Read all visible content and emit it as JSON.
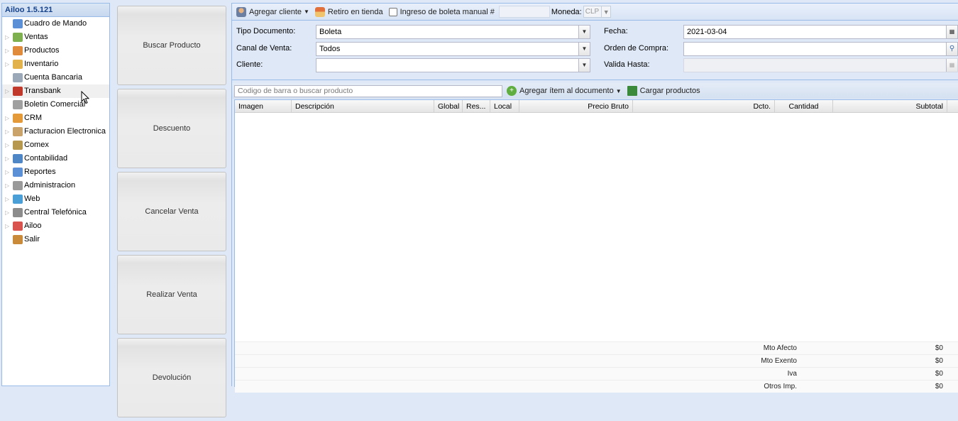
{
  "sidebar": {
    "title": "Ailoo 1.5.121",
    "items": [
      {
        "label": "Cuadro de Mando",
        "expandable": false,
        "icon": "dashboard-icon",
        "color": "#5b8fd6"
      },
      {
        "label": "Ventas",
        "expandable": true,
        "icon": "sales-icon",
        "color": "#7fb04f"
      },
      {
        "label": "Productos",
        "expandable": true,
        "icon": "products-icon",
        "color": "#e08a3c"
      },
      {
        "label": "Inventario",
        "expandable": true,
        "icon": "inventory-icon",
        "color": "#e2b34c"
      },
      {
        "label": "Cuenta Bancaria",
        "expandable": false,
        "icon": "bank-icon",
        "color": "#9aa8b8"
      },
      {
        "label": "Transbank",
        "expandable": true,
        "icon": "transbank-icon",
        "color": "#c0392b"
      },
      {
        "label": "Boletin Comercial",
        "expandable": false,
        "icon": "bulletin-icon",
        "color": "#a0a0a0"
      },
      {
        "label": "CRM",
        "expandable": true,
        "icon": "crm-icon",
        "color": "#e59a3a"
      },
      {
        "label": "Facturacion Electronica",
        "expandable": true,
        "icon": "invoice-icon",
        "color": "#c9a36a"
      },
      {
        "label": "Comex",
        "expandable": true,
        "icon": "comex-icon",
        "color": "#b7984f"
      },
      {
        "label": "Contabilidad",
        "expandable": true,
        "icon": "accounting-icon",
        "color": "#4f86c6"
      },
      {
        "label": "Reportes",
        "expandable": true,
        "icon": "reports-icon",
        "color": "#5b8fd6"
      },
      {
        "label": "Administracion",
        "expandable": true,
        "icon": "admin-gear-icon",
        "color": "#9a9a9a"
      },
      {
        "label": "Web",
        "expandable": true,
        "icon": "web-globe-icon",
        "color": "#4a9fd6"
      },
      {
        "label": "Central Telefónica",
        "expandable": true,
        "icon": "phone-icon",
        "color": "#8c8c8c"
      },
      {
        "label": "Ailoo",
        "expandable": true,
        "icon": "ailoo-logo-icon",
        "color": "#d9534f"
      },
      {
        "label": "Salir",
        "expandable": false,
        "icon": "exit-icon",
        "color": "#c98a3a"
      }
    ]
  },
  "actions": {
    "search_product": "Buscar Producto",
    "discount": "Descuento",
    "cancel_sale": "Cancelar Venta",
    "make_sale": "Realizar Venta",
    "refund": "Devolución"
  },
  "toolbar": {
    "add_client": "Agregar cliente",
    "store_pickup": "Retiro en tienda",
    "manual_receipt": "Ingreso de boleta manual #",
    "manual_receipt_value": "",
    "currency_label": "Moneda:",
    "currency_value": "CLP"
  },
  "form": {
    "doc_type_label": "Tipo Documento:",
    "doc_type_value": "Boleta",
    "channel_label": "Canal de Venta:",
    "channel_value": "Todos",
    "client_label": "Cliente:",
    "client_value": "",
    "date_label": "Fecha:",
    "date_value": "2021-03-04",
    "po_label": "Orden de Compra:",
    "po_value": "",
    "valid_label": "Valida Hasta:",
    "valid_value": ""
  },
  "productbar": {
    "search_placeholder": "Codigo de barra o buscar producto",
    "add_item": "Agregar ítem al documento",
    "load_products": "Cargar productos"
  },
  "grid": {
    "columns": [
      "Imagen",
      "Descripción",
      "Global",
      "Res...",
      "Local",
      "Precio Bruto",
      "Dcto.",
      "Cantidad",
      "Subtotal"
    ],
    "rows": []
  },
  "totals": [
    {
      "label": "Mto Afecto",
      "value": "$0"
    },
    {
      "label": "Mto Exento",
      "value": "$0"
    },
    {
      "label": "Iva",
      "value": "$0"
    },
    {
      "label": "Otros Imp.",
      "value": "$0"
    }
  ]
}
